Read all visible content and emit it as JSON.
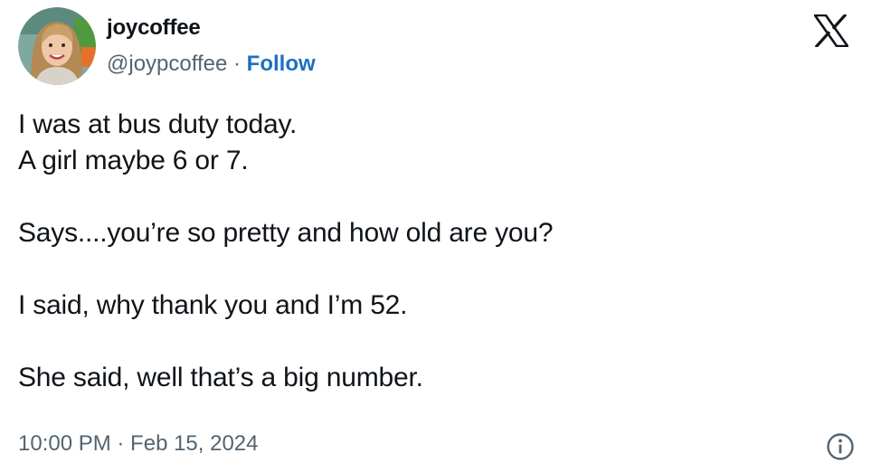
{
  "author": {
    "display_name": "joycoffee",
    "handle": "@joypcoffee",
    "separator": " · ",
    "follow_label": "Follow",
    "avatar_icon": "profile-photo"
  },
  "platform": {
    "logo_icon": "x-logo"
  },
  "tweet": {
    "lines": [
      "I was at bus duty today.",
      "A girl maybe 6 or 7.",
      "Says....you’re so pretty and how old are you?",
      "I said, why thank you and I’m 52.",
      "She said, well that’s a big number."
    ],
    "timestamp": "10:00 PM · Feb 15, 2024"
  },
  "footer": {
    "info_icon": "info-icon"
  },
  "colors": {
    "text": "#0f1419",
    "secondary": "#536471",
    "link": "#1d6fc4"
  }
}
